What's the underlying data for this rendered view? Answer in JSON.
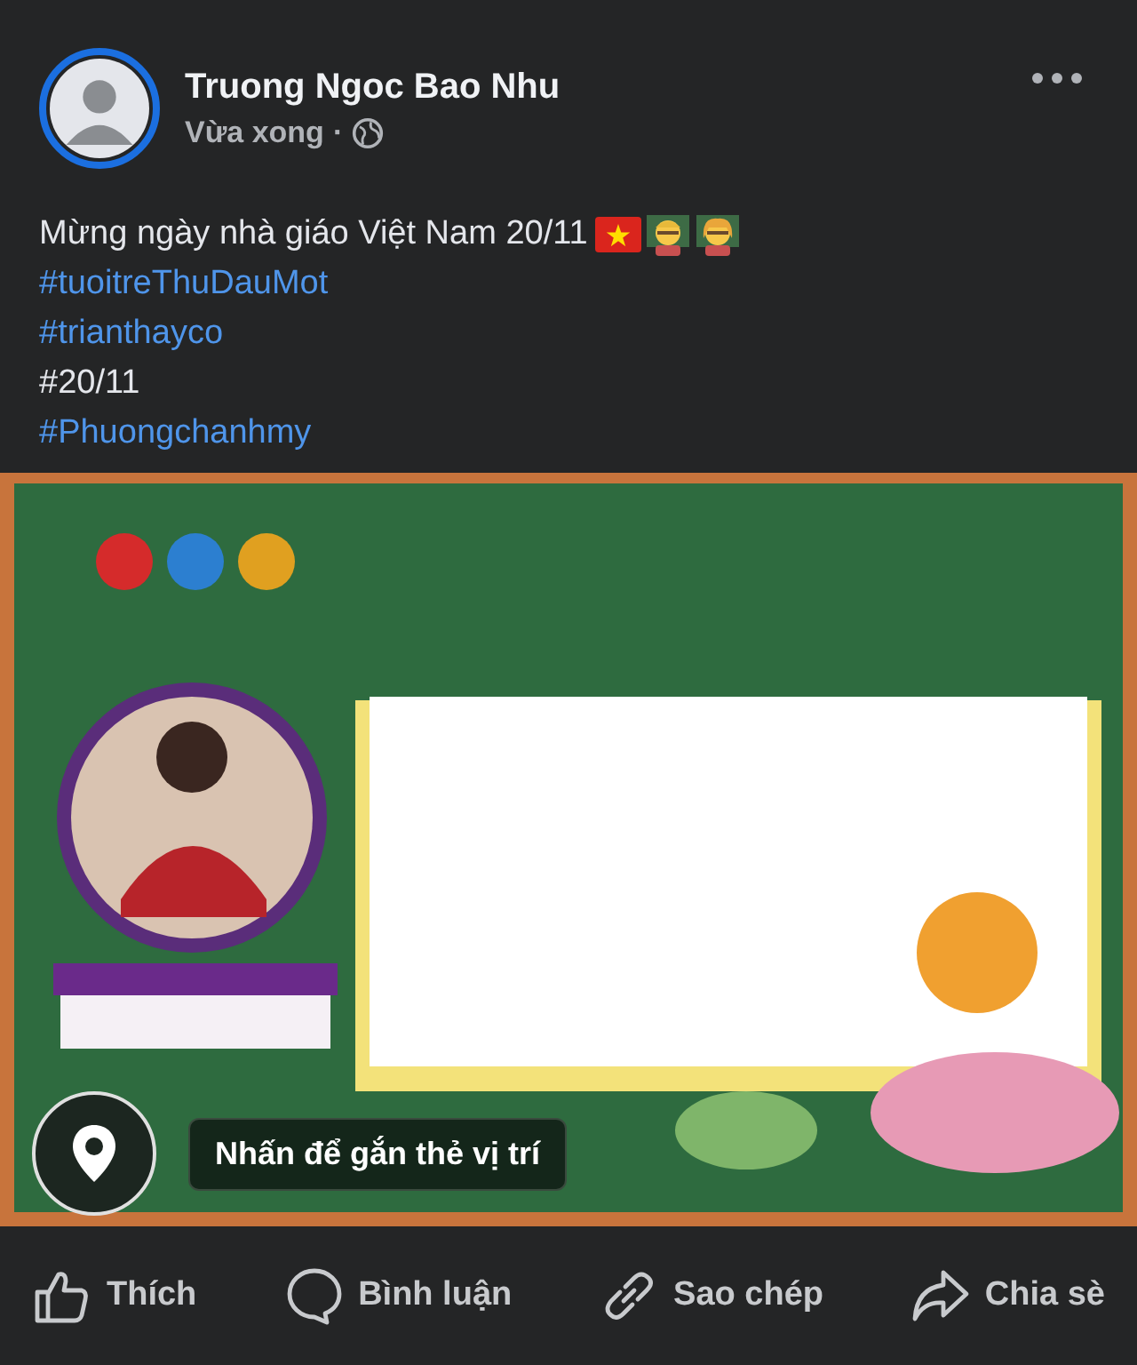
{
  "post": {
    "author": "Truong Ngoc Bao Nhu",
    "time": "Vừa xong",
    "separator": "·",
    "message": "Mừng ngày nhà giáo Việt Nam 20/11",
    "tags": [
      {
        "text": "#tuoitreThuDauMot",
        "kind": "link"
      },
      {
        "text": "#trianthayco",
        "kind": "link"
      },
      {
        "text": "#20/11",
        "kind": "plain"
      },
      {
        "text": "#Phuongchanhmy",
        "kind": "link"
      }
    ],
    "location_tip": "Nhấn để gắn thẻ vị trí"
  },
  "actions": [
    {
      "label": "Thích",
      "kind": "like"
    },
    {
      "label": "Bình luận",
      "kind": "comment"
    },
    {
      "label": "Sao chép",
      "kind": "copy"
    },
    {
      "label": "Chia sè",
      "kind": "share"
    }
  ]
}
